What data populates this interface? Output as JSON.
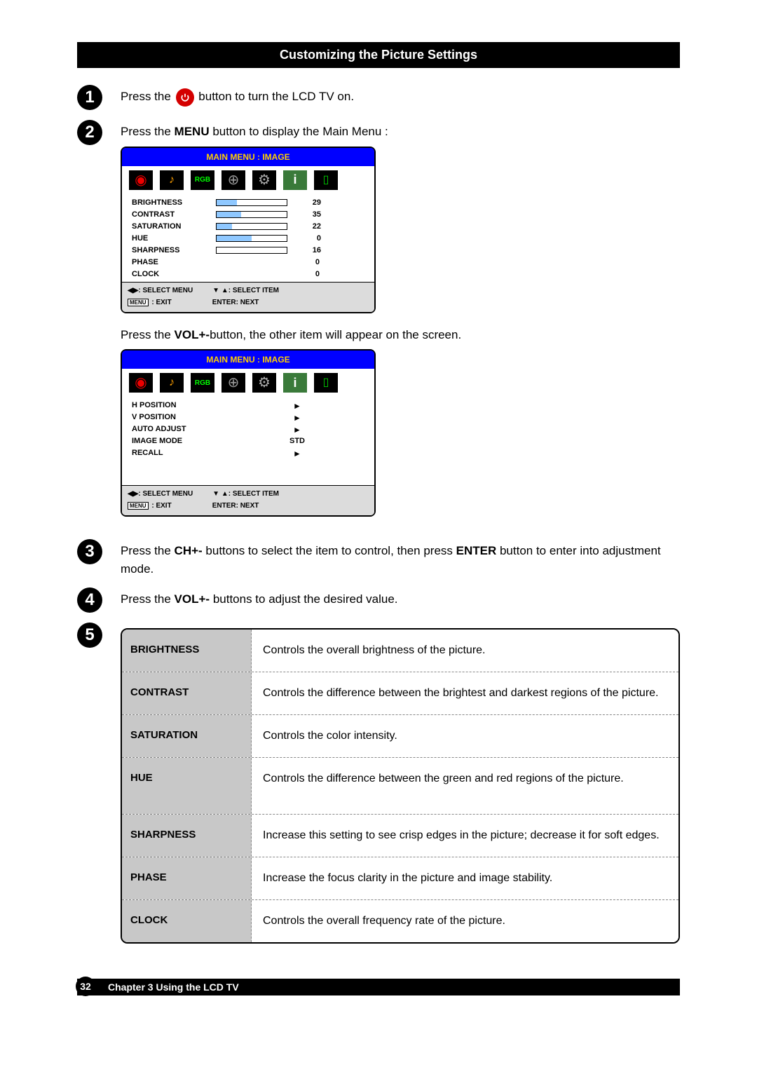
{
  "header": "Customizing the Picture Settings",
  "steps": {
    "s1": {
      "num": "1",
      "pre": "Press the ",
      "post": "button to turn the LCD TV on."
    },
    "s2": {
      "num": "2",
      "pre": "Press the ",
      "bold": "MENU",
      "post": " button to display the Main Menu :"
    },
    "mid": {
      "pre": "Press the ",
      "bold": "VOL+-",
      "post": "button, the other item will appear on the screen."
    },
    "s3": {
      "num": "3",
      "pre": "Press the ",
      "bold1": "CH+-",
      "mid": " buttons to select the item to control, then press ",
      "bold2": "ENTER",
      "post": " button to enter into adjustment mode."
    },
    "s4": {
      "num": "4",
      "pre": "Press the ",
      "bold": "VOL+-",
      "post": " buttons to adjust the desired value."
    },
    "s5": {
      "num": "5"
    }
  },
  "osd": {
    "title": "MAIN MENU : IMAGE",
    "menu1": {
      "rows": [
        {
          "label": "BRIGHTNESS",
          "fill": 29,
          "val": "29"
        },
        {
          "label": "CONTRAST",
          "fill": 35,
          "val": "35"
        },
        {
          "label": "SATURATION",
          "fill": 22,
          "val": "22"
        },
        {
          "label": "HUE",
          "fill": 0,
          "val": "0"
        },
        {
          "label": "SHARPNESS",
          "fill": 16,
          "val": "16"
        },
        {
          "label": "PHASE",
          "fill": -1,
          "val": "0"
        },
        {
          "label": "CLOCK",
          "fill": -1,
          "val": "0"
        }
      ]
    },
    "menu2": {
      "rows": [
        {
          "label": "H POSITION",
          "val": "►"
        },
        {
          "label": "V POSITION",
          "val": "►"
        },
        {
          "label": "AUTO ADJUST",
          "val": "►"
        },
        {
          "label": "IMAGE MODE",
          "val": "STD"
        },
        {
          "label": "RECALL",
          "val": "►"
        }
      ]
    },
    "footer": {
      "selmenu": ": SELECT MENU",
      "selitem": ": SELECT ITEM",
      "menulabel": "MENU",
      "exit": " : EXIT",
      "enter": "ENTER: NEXT"
    }
  },
  "defs": [
    {
      "label": "BRIGHTNESS",
      "desc": "Controls the overall brightness of the picture."
    },
    {
      "label": "CONTRAST",
      "desc": "Controls the difference between the brightest and darkest regions of the picture."
    },
    {
      "label": "SATURATION",
      "desc": "Controls the color intensity."
    },
    {
      "label": "HUE",
      "desc": "Controls the difference between the green and red regions of the picture."
    },
    {
      "label": "SHARPNESS",
      "desc": "Increase this setting to see crisp edges in the picture; decrease it for soft edges."
    },
    {
      "label": "PHASE",
      "desc": "Increase the focus clarity in the picture and image stability."
    },
    {
      "label": "CLOCK",
      "desc": "Controls the overall frequency rate of the picture."
    }
  ],
  "footer": {
    "page": "32",
    "chapter": "Chapter 3 Using the LCD TV"
  }
}
